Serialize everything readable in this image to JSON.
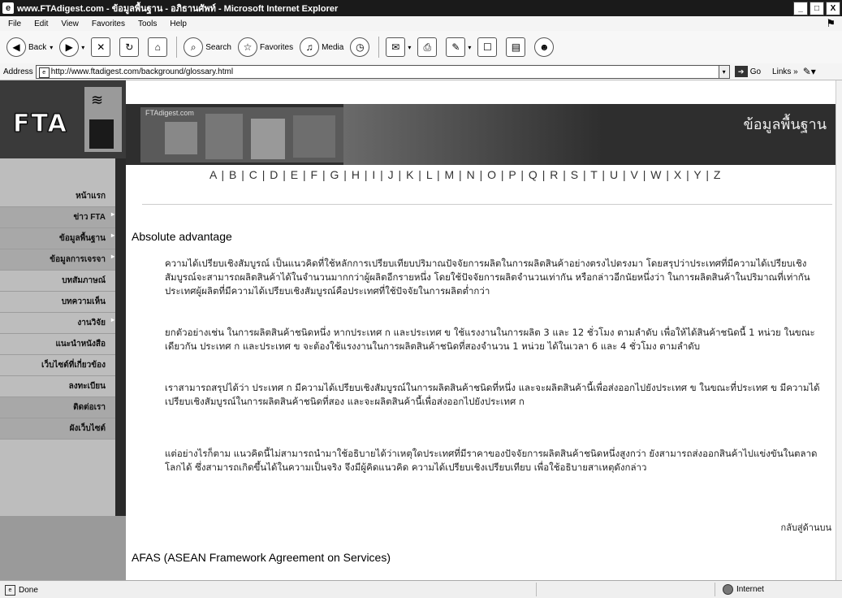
{
  "window": {
    "title": "www.FTAdigest.com - ข้อมูลพื้นฐาน - อภิธานศัพท์ - Microsoft Internet Explorer",
    "minimize": "_",
    "maximize": "□",
    "close": "X"
  },
  "menu": [
    "File",
    "Edit",
    "View",
    "Favorites",
    "Tools",
    "Help"
  ],
  "toolbar": {
    "back": "Back",
    "search": "Search",
    "favorites": "Favorites",
    "media": "Media"
  },
  "address": {
    "label": "Address",
    "url": "http://www.ftadigest.com/background/glossary.html",
    "go": "Go",
    "links": "Links"
  },
  "site": {
    "logo": "FTA",
    "banner_site": "FTAdigest.com",
    "banner_heading": "ข้อมูลพื้นฐาน",
    "alphabet": "A | B | C | D | E | F | G | H | I | J | K | L | M | N | O | P | Q | R | S | T | U | V | W | X | Y | Z"
  },
  "nav": [
    "หน้าแรก",
    "ข่าว FTA",
    "ข้อมูลพื้นฐาน",
    "ข้อมูลการเจรจา",
    "บทสัมภาษณ์",
    "บทความเห็น",
    "งานวิจัย",
    "แนะนำหนังสือ",
    "เว็บไซต์ที่เกี่ยวข้อง",
    "ลงทะเบียน",
    "ติดต่อเรา",
    "ผังเว็บไซต์"
  ],
  "article": {
    "term1": "Absolute advantage",
    "p1": "ความได้เปรียบเชิงสัมบูรณ์ เป็นแนวคิดที่ใช้หลักการเปรียบเทียบปริมาณปัจจัยการผลิตในการผลิตสินค้าอย่างตรงไปตรงมา โดยสรุปว่าประเทศที่มีความได้เปรียบเชิงสัมบูรณ์จะสามารถผลิตสินค้าได้ในจำนวนมากกว่าผู้ผลิตอีกรายหนึ่ง โดยใช้ปัจจัยการผลิตจำนวนเท่ากัน หรือกล่าวอีกนัยหนึ่งว่า ในการผลิตสินค้าในปริมาณที่เท่ากัน ประเทศผู้ผลิตที่มีความได้เปรียบเชิงสัมบูรณ์คือประเทศที่ใช้ปัจจัยในการผลิตต่ำกว่า",
    "p2": "ยกตัวอย่างเช่น ในการผลิตสินค้าชนิดหนึ่ง หากประเทศ ก และประเทศ ข ใช้แรงงานในการผลิต 3 และ 12 ชั่วโมง ตามลำดับ เพื่อให้ได้สินค้าชนิดนี้ 1 หน่วย ในขณะเดียวกัน ประเทศ ก และประเทศ ข จะต้องใช้แรงงานในการผลิตสินค้าชนิดที่สองจำนวน 1 หน่วย ได้ในเวลา 6 และ 4 ชั่วโมง ตามลำดับ",
    "p3": "เราสามารถสรุปได้ว่า ประเทศ ก มีความได้เปรียบเชิงสัมบูรณ์ในการผลิตสินค้าชนิดที่หนึ่ง และจะผลิตสินค้านี้เพื่อส่งออกไปยังประเทศ ข ในขณะที่ประเทศ ข มีความได้เปรียบเชิงสัมบูรณ์ในการผลิตสินค้าชนิดที่สอง และจะผลิตสินค้านี้เพื่อส่งออกไปยังประเทศ ก",
    "p4": "แต่อย่างไรก็ตาม แนวคิดนี้ไม่สามารถนำมาใช้อธิบายได้ว่าเหตุใดประเทศที่มีราคาของปัจจัยการผลิตสินค้าชนิดหนึ่งสูงกว่า ยังสามารถส่งออกสินค้าไปแข่งขันในตลาดโลกได้ ซึ่งสามารถเกิดขึ้นได้ในความเป็นจริง จึงมีผู้คิดแนวคิด ความได้เปรียบเชิงเปรียบเทียบ เพื่อใช้อธิบายสาเหตุดังกล่าว",
    "back_to_top": "กลับสู่ด้านบน",
    "term2": "AFAS (ASEAN Framework Agreement on Services)"
  },
  "status": {
    "text": "Done",
    "zone": "Internet"
  }
}
